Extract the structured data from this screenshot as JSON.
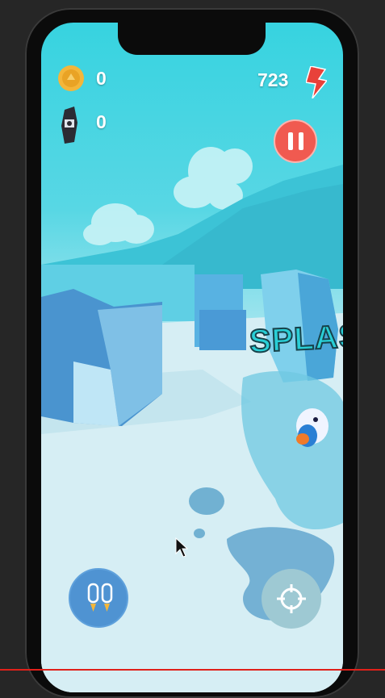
{
  "hud": {
    "coins": "0",
    "gems": "0",
    "energy": "723"
  },
  "scene": {
    "splash_text": "SPLAS"
  },
  "icons": {
    "coin": "coin-icon",
    "gem": "gem-icon",
    "energy": "lightning-icon",
    "pause": "pause-icon",
    "boost": "jetpack-icon",
    "aim": "crosshair-icon",
    "cursor": "mouse-pointer-icon"
  },
  "colors": {
    "sky": "#37d3e0",
    "pause_button": "#f05a50",
    "boost_button": "#4f93d2",
    "energy_icon": "#e8413a",
    "coin": "#f4b63a"
  },
  "video": {
    "progress": 1.0
  }
}
